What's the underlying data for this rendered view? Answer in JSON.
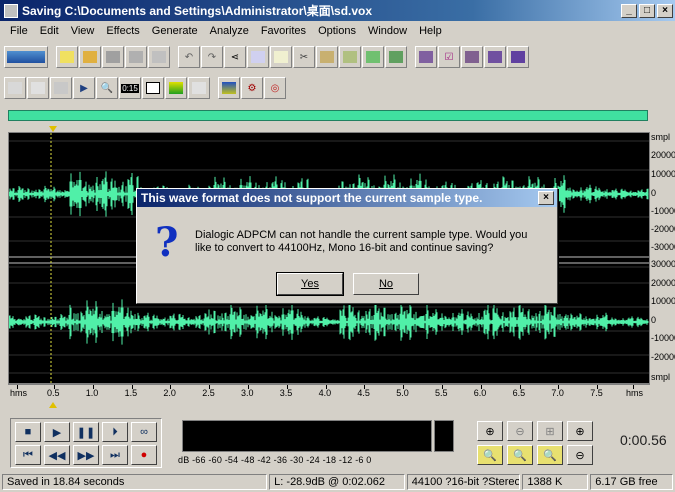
{
  "window": {
    "title": "Saving C:\\Documents and Settings\\Administrator\\桌面\\sd.vox",
    "buttons": [
      "_",
      "□",
      "×"
    ]
  },
  "menu": [
    "File",
    "Edit",
    "View",
    "Effects",
    "Generate",
    "Analyze",
    "Favorites",
    "Options",
    "Window",
    "Help"
  ],
  "waveform": {
    "right_ruler_labels": [
      "smpl",
      "20000",
      "10000",
      "0",
      "-10000",
      "-20000",
      "-30000",
      "30000",
      "20000",
      "10000",
      "0",
      "-10000",
      "-20000",
      "smpl"
    ],
    "time_ruler": [
      "hms",
      "0.5",
      "1.0",
      "1.5",
      "2.0",
      "2.5",
      "3.0",
      "3.5",
      "4.0",
      "4.5",
      "5.0",
      "5.5",
      "6.0",
      "6.5",
      "7.0",
      "7.5",
      "hms"
    ]
  },
  "level_meter": {
    "scale": "dB  -66 -60 -54 -48 -42 -36 -30 -24 -18 -12  -6   0"
  },
  "time_display": "0:00.56",
  "status": {
    "saved": "Saved in 18.84 seconds",
    "level": "L: -28.9dB @  0:02.062",
    "format": "44100 ?16-bit ?Stereo",
    "size": "1388 K",
    "free": "6.17 GB free"
  },
  "dialog": {
    "title": "This wave format does not support the current sample type.",
    "close": "×",
    "icon": "?",
    "message": "Dialogic ADPCM can not handle the current sample type.  Would you like to convert to 44100Hz, Mono 16-bit and continue saving?",
    "yes_label": "Yes",
    "no_label": "No"
  },
  "colors": {
    "waveform": "#50f0a8",
    "title_gradient_start": "#0a246a",
    "navbar": "#40e0a0"
  }
}
